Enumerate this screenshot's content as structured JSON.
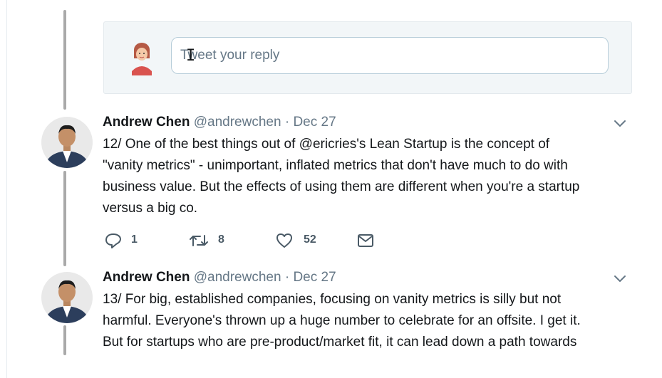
{
  "reply": {
    "placeholder": "Tweet your reply"
  },
  "tweets": [
    {
      "name": "Andrew Chen",
      "handle": "@andrewchen",
      "separator": "·",
      "date": "Dec 27",
      "lines": [
        "12/ One of the best things out of @ericries's Lean Startup is the concept of",
        "\"vanity metrics\" - unimportant, inflated metrics that don't have much to do with",
        "business value. But the effects of using them are different when you're a startup",
        "versus a big co."
      ],
      "replies": "1",
      "retweets": "8",
      "likes": "52"
    },
    {
      "name": "Andrew Chen",
      "handle": "@andrewchen",
      "separator": "·",
      "date": "Dec 27",
      "lines": [
        "13/ For big, established companies, focusing on vanity metrics is silly but not",
        "harmful. Everyone's thrown up a huge number to celebrate for an offsite. I get it.",
        "But for startups who are pre-product/market fit, it can lead down a path towards"
      ]
    }
  ],
  "icons": {
    "reply": "speech-bubble-icon",
    "retweet": "retweet-icon",
    "like": "heart-icon",
    "dm": "envelope-icon",
    "more": "chevron-down-icon"
  },
  "colors": {
    "thread_line": "#a9a9a9",
    "text": "#14171a",
    "muted": "#657786",
    "reply_bg": "#f2f6f8"
  }
}
